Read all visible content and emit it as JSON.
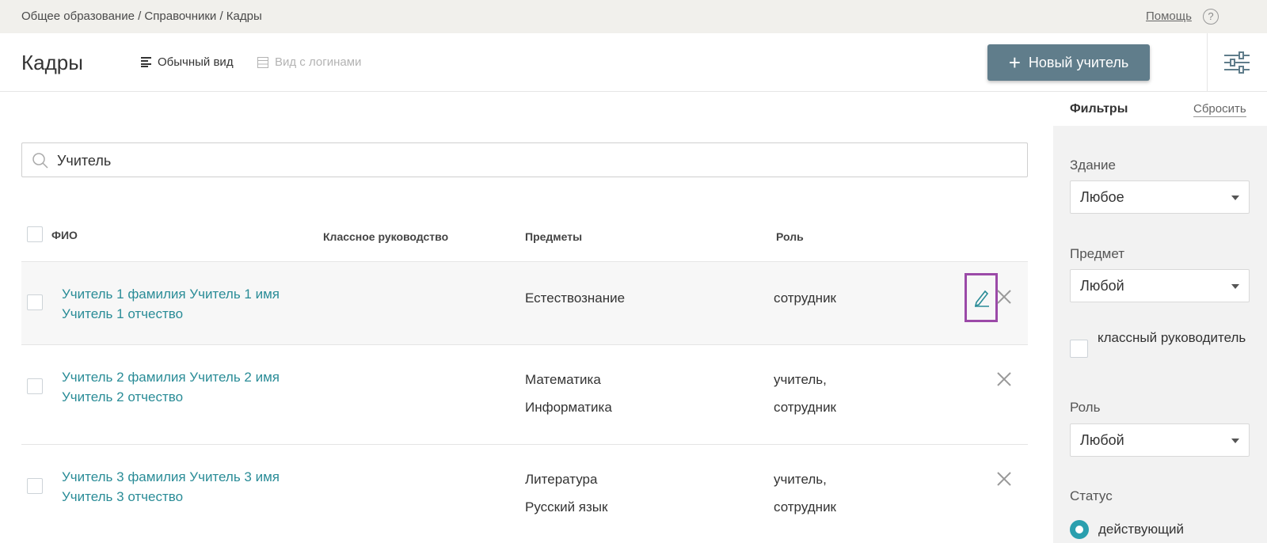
{
  "breadcrumb": "Общее образование / Справочники / Кадры",
  "help": {
    "label": "Помощь",
    "icon": "?"
  },
  "header": {
    "title": "Кадры",
    "view_normal": "Обычный вид",
    "view_logins": "Вид с логинами",
    "new_teacher": "Новый учитель"
  },
  "search": {
    "value": "Учитель"
  },
  "table": {
    "columns": {
      "name": "ФИО",
      "class_lead": "Классное руководство",
      "subjects": "Предметы",
      "role": "Роль"
    },
    "rows": [
      {
        "name_line1": "Учитель 1 фамилия Учитель 1 имя",
        "name_line2": "Учитель 1 отчество",
        "subject1": "Естествознание",
        "subject2": "",
        "role1": "сотрудник",
        "role2": ""
      },
      {
        "name_line1": "Учитель 2 фамилия Учитель 2 имя",
        "name_line2": "Учитель 2 отчество",
        "subject1": "Математика",
        "subject2": "Информатика",
        "role1": "учитель,",
        "role2": "сотрудник"
      },
      {
        "name_line1": "Учитель 3 фамилия Учитель 3 имя",
        "name_line2": "Учитель 3 отчество",
        "subject1": "Литература",
        "subject2": "Русский язык",
        "role1": "учитель,",
        "role2": "сотрудник"
      }
    ]
  },
  "filters": {
    "title": "Фильтры",
    "reset": "Сбросить",
    "building_label": "Здание",
    "building_value": "Любое",
    "subject_label": "Предмет",
    "subject_value": "Любой",
    "class_lead_checkbox": "классный руководитель",
    "role_label": "Роль",
    "role_value": "Любой",
    "status_label": "Статус",
    "status_value": "действующий"
  },
  "colors": {
    "accent": "#607d8b",
    "link": "#2a8c97",
    "highlight_border": "#9b4aa8",
    "radio": "#2a9fae"
  }
}
